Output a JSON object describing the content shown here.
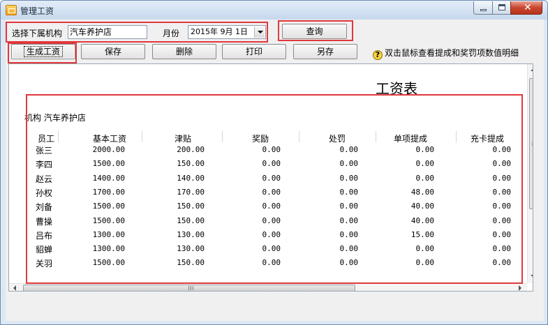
{
  "window": {
    "title": "管理工资"
  },
  "toolbar": {
    "org_label": "选择下属机构",
    "org_value": "汽车养护店",
    "month_label": "月份",
    "month_value": "2015年 9月 1日",
    "query_label": "查询",
    "generate_label": "生成工资",
    "save_label": "保存",
    "delete_label": "删除",
    "print_label": "打印",
    "save_as_label": "另存",
    "help_text": "双击鼠标查看提成和奖罚项数值明细"
  },
  "report": {
    "title": "工资表",
    "org_line": "机构 汽车养护店",
    "columns": [
      "员工",
      "基本工资",
      "津贴",
      "奖励",
      "处罚",
      "单项提成",
      "充卡提成"
    ],
    "rows": [
      [
        "张三",
        "2000.00",
        "200.00",
        "0.00",
        "0.00",
        "0.00",
        "0.00"
      ],
      [
        "李四",
        "1500.00",
        "150.00",
        "0.00",
        "0.00",
        "0.00",
        "0.00"
      ],
      [
        "赵云",
        "1400.00",
        "140.00",
        "0.00",
        "0.00",
        "0.00",
        "0.00"
      ],
      [
        "孙权",
        "1700.00",
        "170.00",
        "0.00",
        "0.00",
        "48.00",
        "0.00"
      ],
      [
        "刘备",
        "1500.00",
        "150.00",
        "0.00",
        "0.00",
        "40.00",
        "0.00"
      ],
      [
        "曹操",
        "1500.00",
        "150.00",
        "0.00",
        "0.00",
        "40.00",
        "0.00"
      ],
      [
        "吕布",
        "1300.00",
        "130.00",
        "0.00",
        "0.00",
        "15.00",
        "0.00"
      ],
      [
        "貂蝉",
        "1300.00",
        "130.00",
        "0.00",
        "0.00",
        "0.00",
        "0.00"
      ],
      [
        "关羽",
        "1500.00",
        "150.00",
        "0.00",
        "0.00",
        "0.00",
        "0.00"
      ]
    ]
  },
  "colors": {
    "highlight": "#e0383b",
    "titlebar": "#c6d8ec",
    "close_button": "#c9452e"
  },
  "icons": [
    "app-icon",
    "minimize-icon",
    "maximize-icon",
    "close-icon",
    "dropdown-arrow-icon",
    "help-icon"
  ]
}
